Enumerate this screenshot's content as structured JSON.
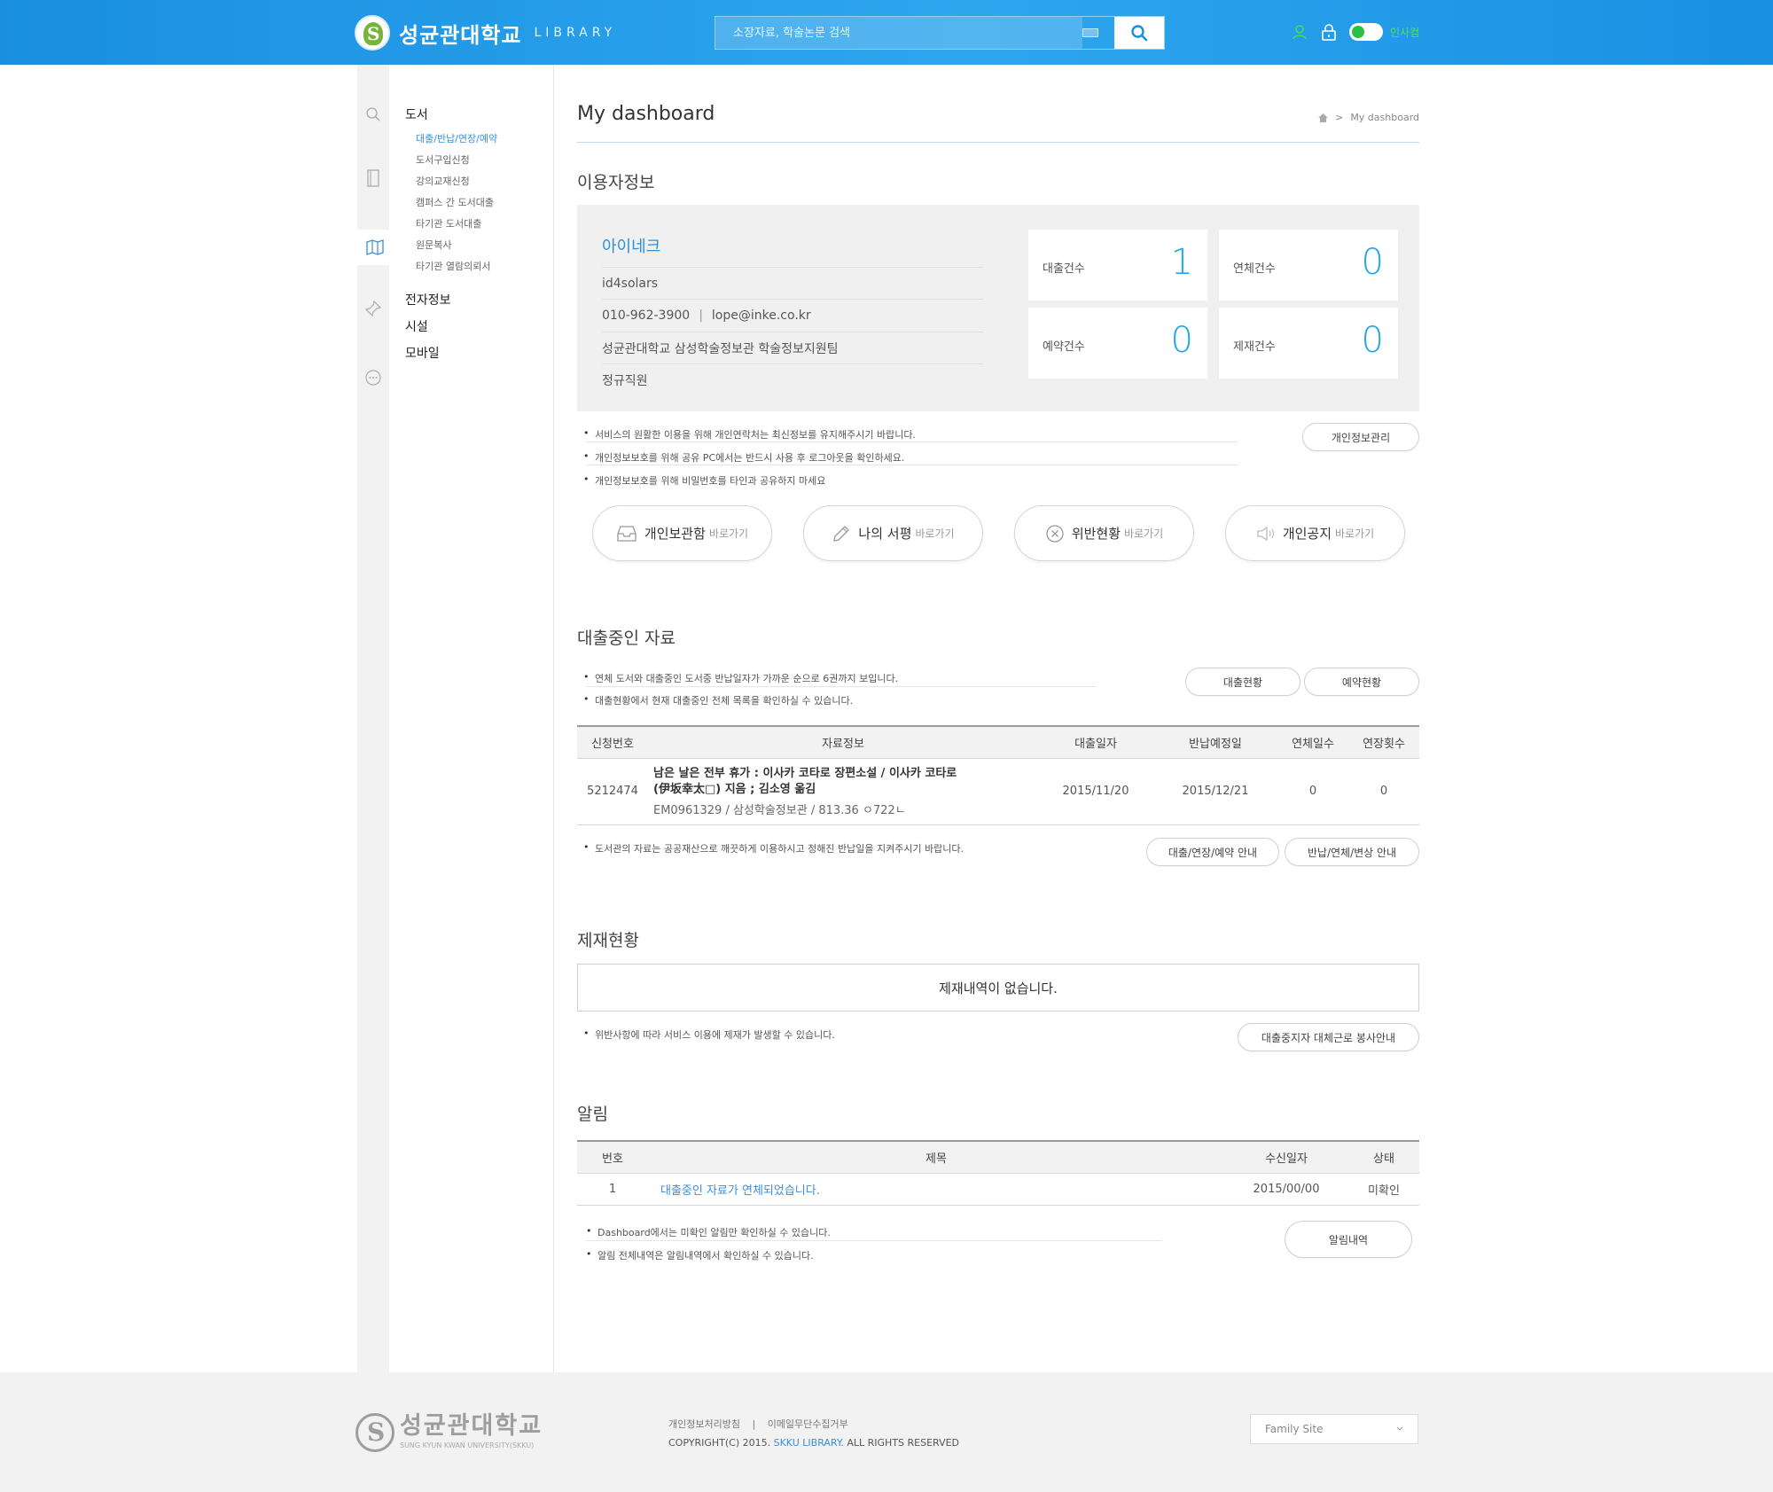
{
  "header": {
    "logo_name": "성균관대학교",
    "logo_sub": "LIBRARY",
    "search_placeholder": "소장자료, 학술논문 검색",
    "login_label": "인사컴"
  },
  "sidebar": {
    "groups": [
      {
        "label": "도서",
        "items": [
          "대출/반납/연장/예약",
          "도서구입신청",
          "강의교재신청",
          "캠퍼스 간 도서대출",
          "타기관 도서대출",
          "원문복사",
          "타기관 열람의뢰서"
        ]
      },
      {
        "label": "전자정보"
      },
      {
        "label": "시설"
      },
      {
        "label": "모바일"
      }
    ]
  },
  "page": {
    "title": "My dashboard",
    "breadcrumb": "My dashboard"
  },
  "user_info": {
    "section_title": "이용자정보",
    "name": "아이네크",
    "id": "id4solars",
    "phone": "010-962-3900",
    "email": "lope@inke.co.kr",
    "department": "성균관대학교 삼성학술정보관 학술정보지원팀",
    "status": "정규직원",
    "stats": [
      {
        "label": "대출건수",
        "value": "1"
      },
      {
        "label": "연체건수",
        "value": "0"
      },
      {
        "label": "예약건수",
        "value": "0"
      },
      {
        "label": "제재건수",
        "value": "0"
      }
    ],
    "notes": [
      "서비스의 원활한 이용을 위해 개인연락처는 최신정보를 유지해주시기 바랍니다.",
      "개인정보보호를 위해 공유 PC에서는 반드시 사용 후 로그아웃을 확인하세요.",
      "개인정보보호를 위해 비밀번호를 타인과 공유하지 마세요"
    ],
    "manage_button": "개인정보관리"
  },
  "quick_links": [
    {
      "main": "개인보관함",
      "sub": "바로가기"
    },
    {
      "main": "나의 서평",
      "sub": "바로가기"
    },
    {
      "main": "위반현황",
      "sub": "바로가기"
    },
    {
      "main": "개인공지",
      "sub": "바로가기"
    }
  ],
  "loans": {
    "section_title": "대출중인 자료",
    "notes": [
      "연체 도서와 대출중인 도서중 반납일자가 가까운 순으로 6권까지 보입니다.",
      "대출현황에서 현재 대출중인 전체 목록을 확인하실 수 있습니다."
    ],
    "buttons": [
      "대출현황",
      "예약현황"
    ],
    "columns": [
      "신청번호",
      "자료정보",
      "대출일자",
      "반납예정일",
      "연체일수",
      "연장횟수"
    ],
    "rows": [
      {
        "no": "5212474",
        "title_line1": "남은 날은 전부 휴가 : 이사카 코타로 장편소설 / 이사카 코타로",
        "title_line2": "(伊坂幸太□) 지음 ; 김소영 옮김",
        "meta": "EM0961329 / 삼성학술정보관 / 813.36 ㅇ722ㄴ",
        "loan_date": "2015/11/20",
        "due_date": "2015/12/21",
        "overdue_days": "0",
        "renewals": "0"
      }
    ],
    "footer_note": "도서관의 자료는 공공재산으로 깨끗하게 이용하시고 정해진 반납일을 지켜주시기 바랍니다.",
    "footer_buttons": [
      "대출/연장/예약 안내",
      "반납/연체/변상 안내"
    ]
  },
  "sanctions": {
    "section_title": "제재현황",
    "empty_message": "제재내역이 없습니다.",
    "note": "위반사항에 따라 서비스 이용에 제재가 발생할 수 있습니다.",
    "button": "대출중지자 대체근로 봉사안내"
  },
  "alerts": {
    "section_title": "알림",
    "columns": [
      "번호",
      "제목",
      "수신일자",
      "상태"
    ],
    "rows": [
      {
        "no": "1",
        "title": "대출중인 자료가 연체되었습니다.",
        "date": "2015/00/00",
        "status": "미확인"
      }
    ],
    "notes": [
      "Dashboard에서는 미확인 알림만 확인하실 수 있습니다.",
      "알림 전체내역은 알림내역에서 확인하실 수 있습니다."
    ],
    "button": "알림내역"
  },
  "footer": {
    "logo_name": "성균관대학교",
    "logo_sub": "SUNG KYUN KWAN UNIVERSITY(SKKU)",
    "links": [
      "개인정보처리방침",
      "이메일무단수집거부"
    ],
    "copyright_prefix": "COPYRIGHT(C) 2015.",
    "copyright_brand": "SKKU LIBRARY.",
    "copyright_suffix": "ALL RIGHTS RESERVED",
    "family_site": "Family Site"
  },
  "colors": {
    "header_blue": "#1a8fe0",
    "accent_blue": "#23a5e8",
    "link_blue": "#3a8fd9",
    "login_green": "#27c144"
  }
}
